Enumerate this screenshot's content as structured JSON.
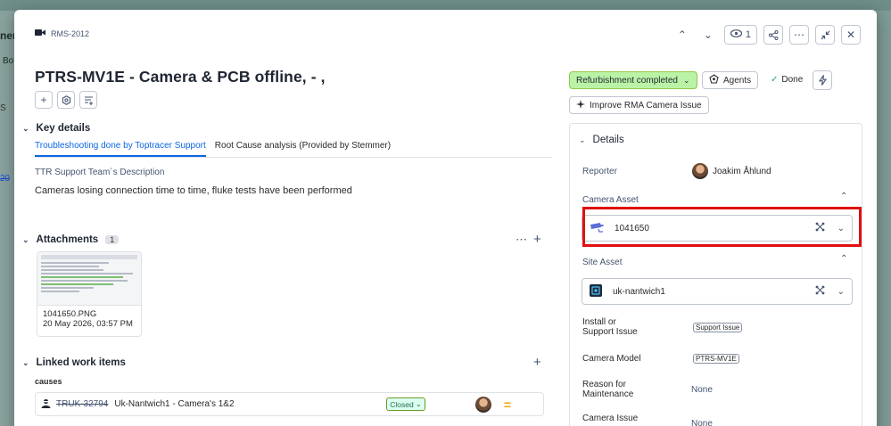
{
  "background": {
    "fragment_top": "ner",
    "fragment_mid": "Bo",
    "fragment_search": "S",
    "fragment_link": "20"
  },
  "header": {
    "issue_key": "RMS-2012",
    "watch_count": "1",
    "title": "PTRS-MV1E - Camera & PCB offline, - ,"
  },
  "key_details": {
    "heading": "Key details",
    "tabs": [
      {
        "label": "Troubleshooting done by Toptracer Support",
        "active": true
      },
      {
        "label": "Root Cause analysis (Provided by Stemmer)",
        "active": false
      }
    ],
    "field_label": "TTR Support Team´s Description",
    "field_value": "Cameras losing connection time to time, fluke tests have been performed"
  },
  "attachments": {
    "heading": "Attachments",
    "count": "1",
    "items": [
      {
        "file_name": "1041650.PNG",
        "date": "20 May 2026, 03:57 PM"
      }
    ]
  },
  "linked": {
    "heading": "Linked work items",
    "group_label": "causes",
    "items": [
      {
        "key": "TRUK-32794",
        "summary": "Uk-Nantwich1 - Camera's 1&2",
        "status": "Closed",
        "priority": "="
      }
    ]
  },
  "sidebar": {
    "status": "Refurbishment completed",
    "agents_label": "Agents",
    "done_label": "Done",
    "improve_label": "Improve RMA Camera Issue",
    "details_heading": "Details",
    "reporter_label": "Reporter",
    "reporter_name": "Joakim Åhlund",
    "camera_asset_label": "Camera Asset",
    "camera_asset_value": "1041650",
    "site_asset_label": "Site Asset",
    "site_asset_value": "uk-nantwich1",
    "install_label_1": "Install or",
    "install_label_2": "Support Issue",
    "install_value": "Support Issue",
    "camera_model_label": "Camera Model",
    "camera_model_value": "PTRS-MV1E",
    "reason_label_1": "Reason for",
    "reason_label_2": "Maintenance",
    "reason_value": "None",
    "camera_issue_label": "Camera Issue",
    "camera_issue_value": "None"
  },
  "colors": {
    "accent": "#0c66e4",
    "status_green": "#baf3a5",
    "highlight_red": "#e01010",
    "priority_medium": "#f5a300"
  },
  "icons": [
    "video-camera-icon",
    "chevron-up-icon",
    "chevron-down-icon",
    "eye-icon",
    "share-icon",
    "more-icon",
    "minimize-icon",
    "close-icon",
    "plus-icon",
    "settings-icon",
    "list-add-icon",
    "lightning-icon",
    "sparkle-icon",
    "check-icon",
    "agents-icon",
    "camera-asset-icon",
    "site-asset-icon",
    "expand-nodes-icon",
    "agent-avatar-icon"
  ]
}
